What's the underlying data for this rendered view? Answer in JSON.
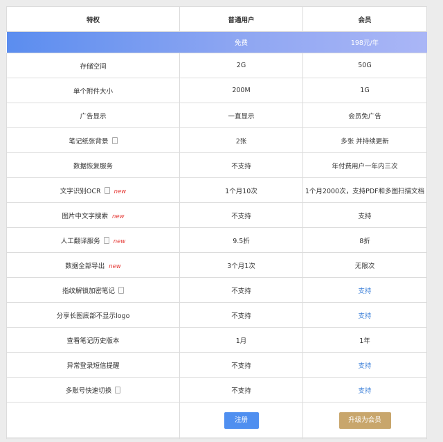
{
  "header": {
    "col1": "特权",
    "col2": "普通用户",
    "col3": "会员"
  },
  "price": {
    "free": "免费",
    "member": "198元/年"
  },
  "rows": [
    {
      "label": "存储空间",
      "icon": false,
      "new": false,
      "normal": "2G",
      "member": "50G",
      "member_blue": false
    },
    {
      "label": "单个附件大小",
      "icon": false,
      "new": false,
      "normal": "200M",
      "member": "1G",
      "member_blue": false
    },
    {
      "label": "广告显示",
      "icon": false,
      "new": false,
      "normal": "一直显示",
      "member": "会员免广告",
      "member_blue": false
    },
    {
      "label": "笔记纸张背景",
      "icon": true,
      "new": false,
      "normal": "2张",
      "member": "多张 并持续更新",
      "member_blue": false
    },
    {
      "label": "数据恢复服务",
      "icon": false,
      "new": false,
      "normal": "不支持",
      "member": "年付费用户一年内三次",
      "member_blue": false
    },
    {
      "label": "文字识别OCR",
      "icon": true,
      "new": true,
      "normal": "1个月10次",
      "member": "1个月2000次，支持PDF和多图扫描文档",
      "member_blue": false
    },
    {
      "label": "图片中文字搜索",
      "icon": false,
      "new": true,
      "normal": "不支持",
      "member": "支持",
      "member_blue": false
    },
    {
      "label": "人工翻译服务",
      "icon": true,
      "new": true,
      "normal": "9.5折",
      "member": "8折",
      "member_blue": false
    },
    {
      "label": "数据全部导出",
      "icon": false,
      "new": true,
      "normal": "3个月1次",
      "member": "无限次",
      "member_blue": false
    },
    {
      "label": "指纹解锁加密笔记",
      "icon": true,
      "new": false,
      "normal": "不支持",
      "member": "支持",
      "member_blue": true
    },
    {
      "label": "分享长图底部不显示logo",
      "icon": false,
      "new": false,
      "normal": "不支持",
      "member": "支持",
      "member_blue": true
    },
    {
      "label": "查看笔记历史版本",
      "icon": false,
      "new": false,
      "normal": "1月",
      "member": "1年",
      "member_blue": false
    },
    {
      "label": "异常登录短信提醒",
      "icon": false,
      "new": false,
      "normal": "不支持",
      "member": "支持",
      "member_blue": true
    },
    {
      "label": "多账号快速切换",
      "icon": true,
      "new": false,
      "normal": "不支持",
      "member": "支持",
      "member_blue": true
    }
  ],
  "new_tag": "new",
  "buttons": {
    "register": "注册",
    "upgrade": "升级为会员"
  },
  "colors": {
    "link_blue": "#3b7fd8",
    "new_red": "#e53935",
    "register_btn": "#4f8ff0",
    "upgrade_btn": "#c8a66c"
  }
}
